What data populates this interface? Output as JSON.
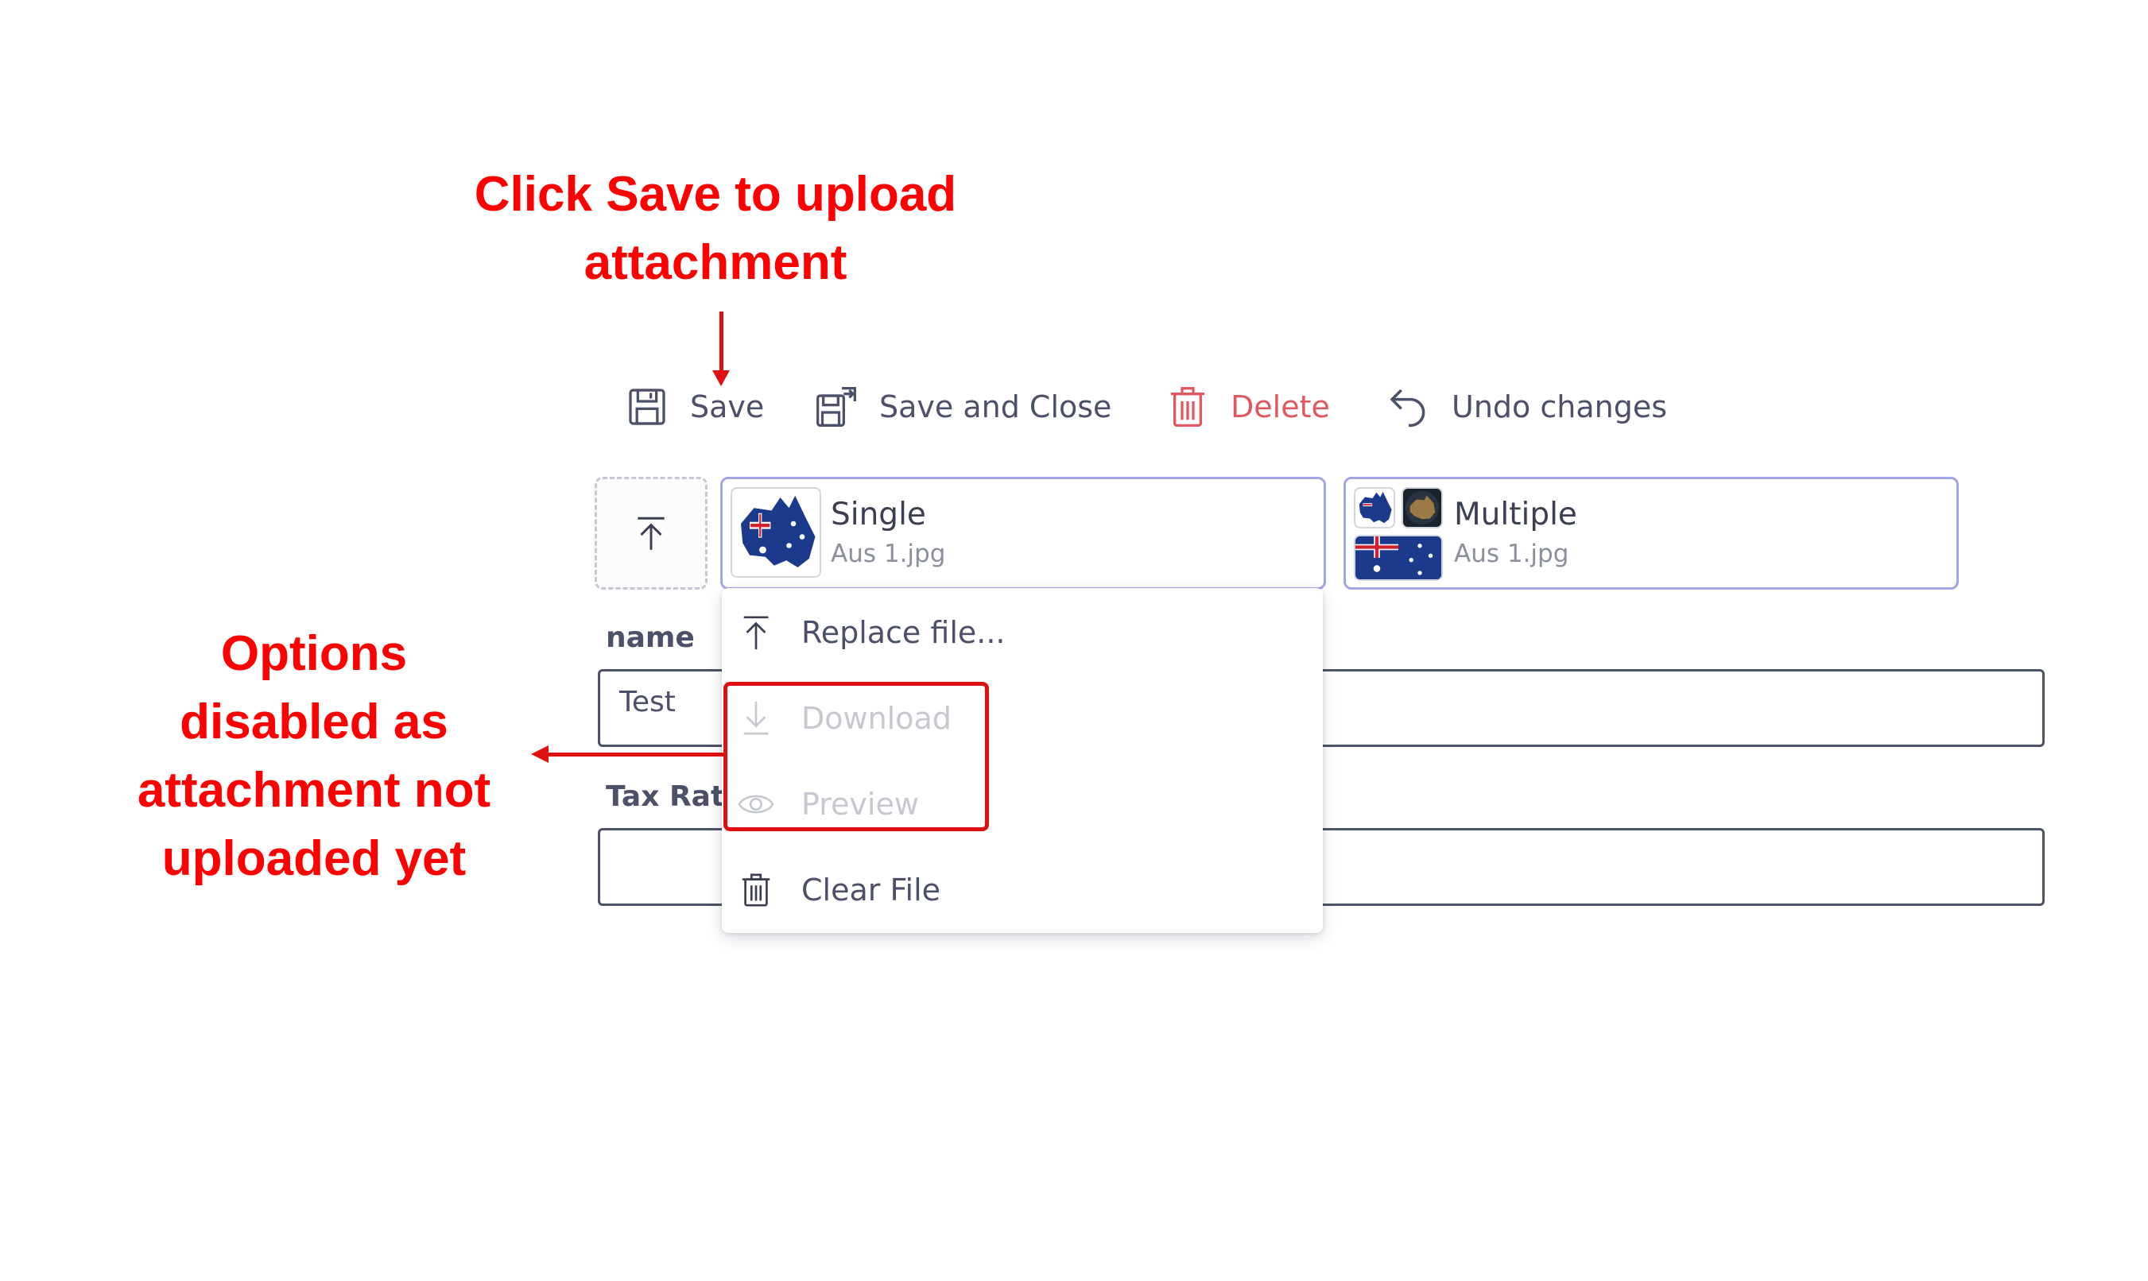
{
  "annotations": {
    "top_line1": "Click Save to upload",
    "top_line2": "attachment",
    "left_line1": "Options",
    "left_line2": "disabled as",
    "left_line3": "attachment not",
    "left_line4": "uploaded yet"
  },
  "toolbar": {
    "save_label": "Save",
    "save_close_label": "Save and Close",
    "delete_label": "Delete",
    "undo_label": "Undo changes"
  },
  "attachments": {
    "single": {
      "title": "Single",
      "filename": "Aus 1.jpg"
    },
    "multiple": {
      "title": "Multiple",
      "filename": "Aus 1.jpg"
    }
  },
  "form": {
    "name_label": "name",
    "name_value": "Test",
    "tax_label": "Tax Rat"
  },
  "menu": {
    "replace_label": "Replace file...",
    "download_label": "Download",
    "preview_label": "Preview",
    "clear_label": "Clear File"
  },
  "colors": {
    "annotation": "#ff0000",
    "card_border": "#a3a6e6",
    "delete": "#e0585f",
    "text": "#4a5168",
    "disabled": "#c6c8cf"
  },
  "icons": [
    "floppy-disk-icon",
    "save-close-icon",
    "trash-icon",
    "undo-icon",
    "upload-icon",
    "download-icon",
    "eye-icon"
  ]
}
